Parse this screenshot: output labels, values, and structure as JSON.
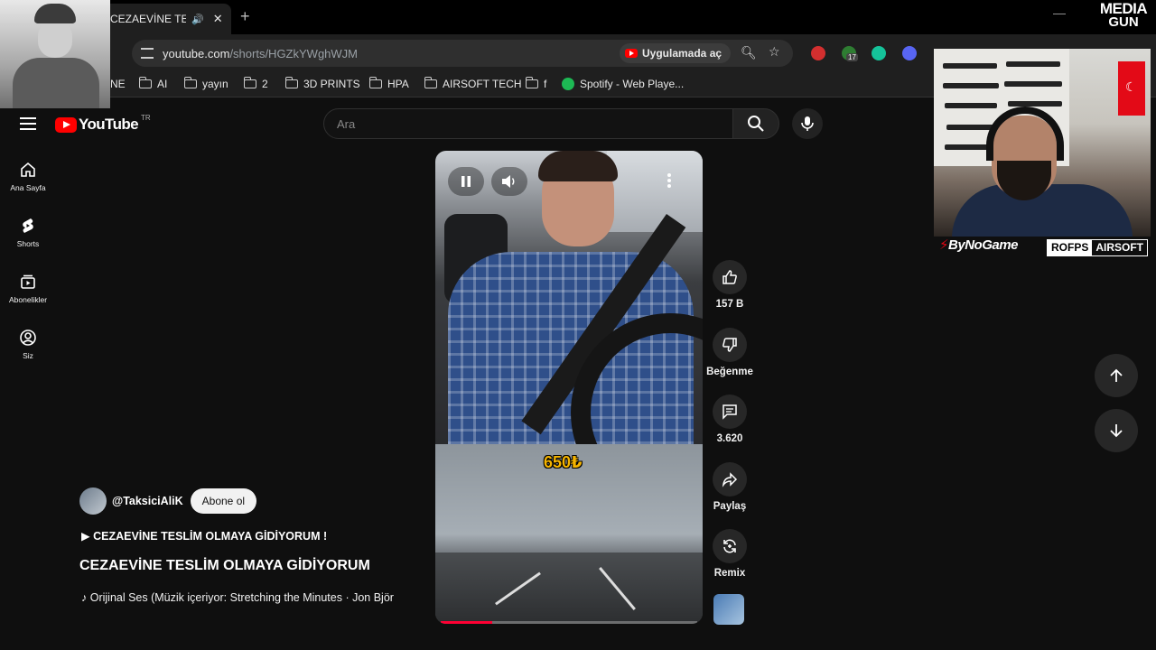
{
  "browser": {
    "tab_title": "CEZAEVİNE TESLİM OLMAYA GİDİYORUM",
    "url_host": "youtube.com",
    "url_path": "/shorts/HGZkYWghWJM",
    "open_in_app": "Uygulamada aç",
    "extension_badge": "17",
    "bookmarks": [
      {
        "label": "NE"
      },
      {
        "label": "AI"
      },
      {
        "label": "yayın"
      },
      {
        "label": "2"
      },
      {
        "label": "3D PRINTS"
      },
      {
        "label": "HPA"
      },
      {
        "label": "AIRSOFT TECH"
      },
      {
        "label": "f"
      },
      {
        "label": "Spotify - Web Playe..."
      }
    ]
  },
  "youtube": {
    "logo_text": "YouTube",
    "country_code": "TR",
    "search_placeholder": "Ara",
    "guide": [
      {
        "label": "Ana Sayfa",
        "icon": "home-icon"
      },
      {
        "label": "Shorts",
        "icon": "shorts-icon"
      },
      {
        "label": "Abonelikler",
        "icon": "subscriptions-icon"
      },
      {
        "label": "Siz",
        "icon": "account-icon"
      }
    ],
    "short": {
      "overlay_price": "650₺",
      "progress": 0.2,
      "actions": {
        "like_count": "157 B",
        "dislike_label": "Beğenme",
        "comment_count": "3.620",
        "share_label": "Paylaş",
        "remix_label": "Remix"
      },
      "channel_handle": "@TaksiciAliK",
      "subscribe_label": "Abone ol",
      "description": "▶ CEZAEVİNE TESLİM OLMAYA GİDİYORUM !",
      "title": "CEZAEVİNE TESLİM OLMAYA GİDİYORUM",
      "music": "♪ Orijinal Ses (Müzik içeriyor: Stretching the Minutes · Jon Björ"
    }
  },
  "overlay": {
    "brand_top": "MEDIA",
    "brand_bottom": "GUN",
    "streamer_logo": "ByNoGame",
    "sponsor_left": "ROFPS",
    "sponsor_right": "AIRSOFT"
  }
}
